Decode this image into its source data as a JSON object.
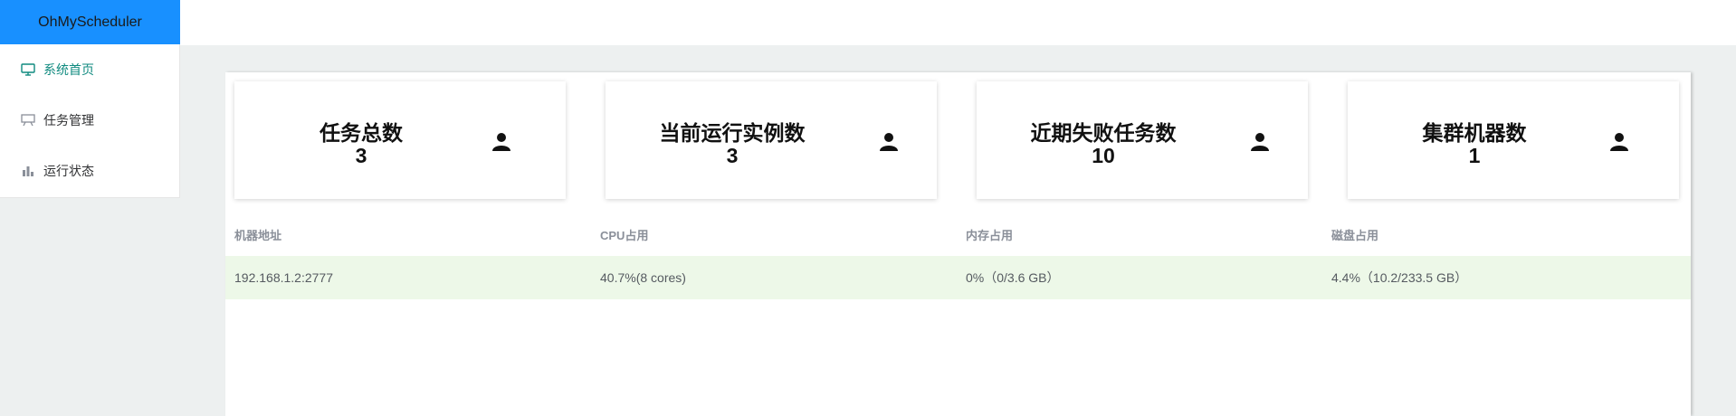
{
  "app": {
    "title": "OhMyScheduler",
    "brand_color": "#1890ff"
  },
  "sidebar": {
    "items": [
      {
        "label": "系统首页",
        "icon": "monitor-icon",
        "active": true
      },
      {
        "label": "任务管理",
        "icon": "presentation-icon",
        "active": false
      },
      {
        "label": "运行状态",
        "icon": "bar-chart-icon",
        "active": false
      }
    ]
  },
  "stats": [
    {
      "title": "任务总数",
      "value": "3",
      "icon": "user-icon"
    },
    {
      "title": "当前运行实例数",
      "value": "3",
      "icon": "user-icon"
    },
    {
      "title": "近期失败任务数",
      "value": "10",
      "icon": "user-icon"
    },
    {
      "title": "集群机器数",
      "value": "1",
      "icon": "user-icon"
    }
  ],
  "table": {
    "columns": [
      "机器地址",
      "CPU占用",
      "内存占用",
      "磁盘占用"
    ],
    "rows": [
      [
        "192.168.1.2:2777",
        "40.7%(8 cores)",
        "0%（0/3.6 GB）",
        "4.4%（10.2/233.5 GB）"
      ]
    ]
  }
}
